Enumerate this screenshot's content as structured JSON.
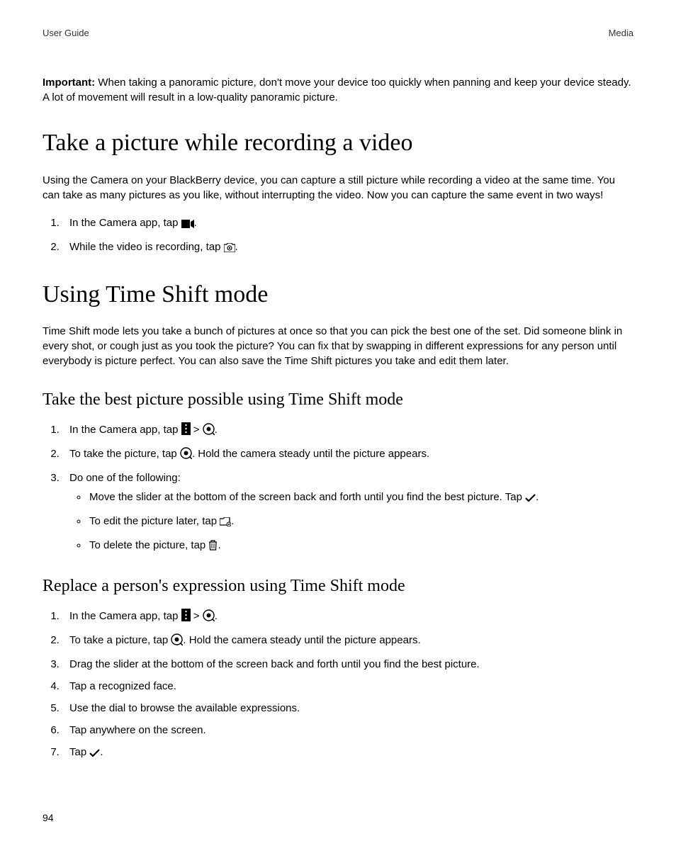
{
  "header": {
    "left": "User Guide",
    "right": "Media"
  },
  "important": {
    "label": "Important:",
    "text": " When taking a panoramic picture, don't move your device too quickly when panning and keep your device steady. A lot of movement will result in a low-quality panoramic picture."
  },
  "section1": {
    "title": "Take a picture while recording a video",
    "intro": "Using the Camera on your BlackBerry device, you can capture a still picture while recording a video at the same time. You can take as many pictures as you like, without interrupting the video. Now you can capture the same event in two ways!",
    "step1_a": "In the Camera app, tap ",
    "step1_b": ".",
    "step2_a": "While the video is recording, tap ",
    "step2_b": "."
  },
  "section2": {
    "title": "Using Time Shift mode",
    "intro": "Time Shift mode lets you take a bunch of pictures at once so that you can pick the best one of the set. Did someone blink in every shot, or cough just as you took the picture? You can fix that by swapping in different expressions for any person until everybody is picture perfect. You can also save the Time Shift pictures you take and edit them later.",
    "sub1": {
      "title": "Take the best picture possible using Time Shift mode",
      "s1a": "In the Camera app, tap ",
      "s1b": " > ",
      "s1c": ".",
      "s2a": "To take the picture, tap ",
      "s2b": ". Hold the camera steady until the picture appears.",
      "s3": "Do one of the following:",
      "b1a": "Move the slider at the bottom of the screen back and forth until you find the best picture. Tap ",
      "b1b": ".",
      "b2a": "To edit the picture later, tap ",
      "b2b": ".",
      "b3a": "To delete the picture, tap ",
      "b3b": "."
    },
    "sub2": {
      "title": "Replace a person's expression using Time Shift mode",
      "s1a": "In the Camera app, tap ",
      "s1b": " > ",
      "s1c": ".",
      "s2a": "To take a picture, tap ",
      "s2b": ". Hold the camera steady until the picture appears.",
      "s3": "Drag the slider at the bottom of the screen back and forth until you find the best picture.",
      "s4": "Tap a recognized face.",
      "s5": "Use the dial to browse the available expressions.",
      "s6": "Tap anywhere on the screen.",
      "s7a": "Tap ",
      "s7b": "."
    }
  },
  "pageNumber": "94"
}
